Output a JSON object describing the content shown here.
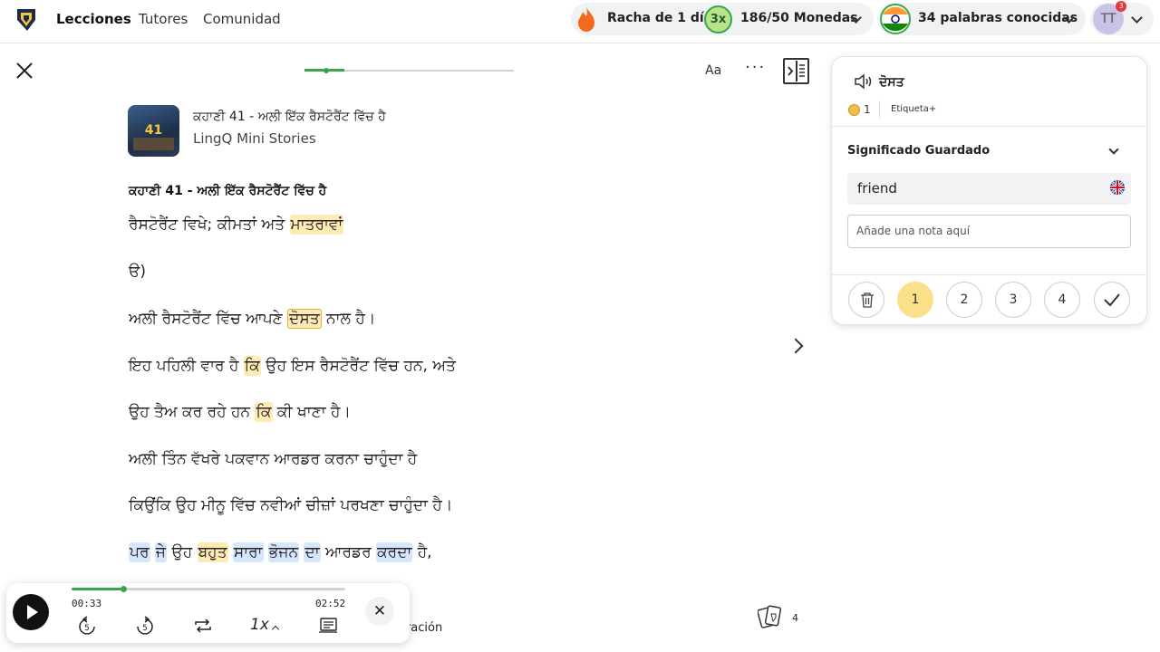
{
  "topbar": {
    "nav": [
      "Lecciones",
      "Tutores",
      "Comunidad"
    ],
    "streak": "Racha de 1 día",
    "multiplier": "3x",
    "coins": "186/50 Monedas",
    "known_words": "34 palabras conocidas",
    "avatar_initials": "TT",
    "notifications": "3"
  },
  "reader": {
    "font_button": "Aa",
    "more_button": "···",
    "cover_number": "41",
    "lesson_title": "ਕਹਾਣੀ 41 - ਅਲੀ ਇੱਕ ਰੈਸਟੋਰੈਂਟ ਵਿੱਚ ਹੈ",
    "course": "LingQ Mini Stories",
    "heading": "ਕਹਾਣੀ 41 - ਅਲੀ ਇੱਕ ਰੈਸਟੋਰੈਂਟ ਵਿੱਚ ਹੈ",
    "lines": [
      {
        "pre": "ਰੈਸਟੋਰੈਂਟ ਵਿਖੇ; ਕੀਮਤਾਂ ਅਤੇ ",
        "hl": "ਮਾਤਰਾਵਾਂ",
        "post": ""
      },
      {
        "pre": "ੳ)",
        "hl": "",
        "post": ""
      },
      {
        "pre": "ਅਲੀ ਰੈਸਟੋਰੈਂਟ ਵਿੱਚ ਆਪਣੇ ",
        "hl": "ਦੋਸਤ",
        "post": " ਨਾਲ ਹੈ।"
      },
      {
        "pre": "ਇਹ ਪਹਿਲੀ ਵਾਰ ਹੈ ",
        "hl": "ਕਿ",
        "post": " ਉਹ ਇਸ ਰੈਸਟੋਰੈਂਟ ਵਿੱਚ ਹਨ, ਅਤੇ"
      },
      {
        "pre": "ਉਹ ਤੈਅ ਕਰ ਰਹੇ ਹਨ ",
        "hl": "ਕਿ",
        "post": " ਕੀ ਖਾਣਾ ਹੈ।"
      },
      {
        "pre": "ਅਲੀ ਤਿੰਨ ਵੱਖਰੇ ਪਕਵਾਨ ਆਰਡਰ ਕਰਨਾ ਚਾਹੁੰਦਾ ਹੈ",
        "hl": "",
        "post": ""
      },
      {
        "pre": "ਕਿਉਂਕਿ ਉਹ ਮੀਨੂ ਵਿੱਚ ਨਵੀਆਂ ਚੀਜ਼ਾਂ ਪਰਖਣਾ ਚਾਹੁੰਦਾ ਹੈ।",
        "hl": "",
        "post": ""
      }
    ],
    "last_line": {
      "w1": "ਪਰ",
      "w2": "ਜੇ",
      "w3": "ਉਹ",
      "w4": "ਬਹੁਤ",
      "w5": "ਸਾਰਾ",
      "w6": "ਭੋਜਨ",
      "w7": "ਦਾ",
      "w8": "ਆਰਡਰ",
      "w9": "ਕਰਦਾ",
      "w10": "ਹੈ,"
    }
  },
  "panel": {
    "word": "ਦੋਸਤ",
    "coin_count": "1",
    "tag_label": "Etiqueta+",
    "saved_label": "Significado Guardado",
    "meaning": "friend",
    "note_placeholder": "Añade una nota aquí",
    "levels": [
      "1",
      "2",
      "3",
      "4"
    ],
    "selected_level": "1"
  },
  "player": {
    "current_time": "00:33",
    "total_time": "02:52",
    "progress": 0.19,
    "rewind": "5",
    "forward": "5",
    "speed": "1x",
    "close": "✕"
  },
  "bottom": {
    "partial_label": "oración",
    "cards_count": "4"
  },
  "colors": {
    "accent_green": "#3aa64b",
    "highlight_yellow": "#fdebb3",
    "highlight_blue": "#d6e7fb",
    "level_selected": "#fbe08a"
  }
}
